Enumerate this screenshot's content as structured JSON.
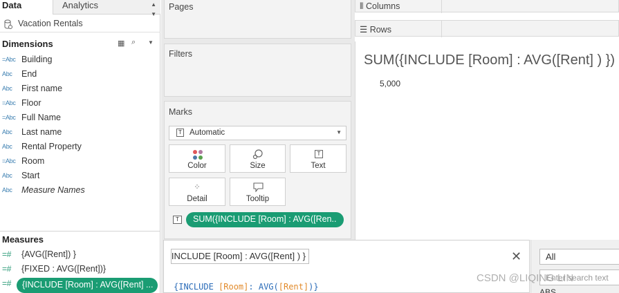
{
  "tabs": {
    "data": "Data",
    "analytics": "Analytics"
  },
  "datasource": "Vacation Rentals",
  "dimensions": {
    "title": "Dimensions",
    "fields": [
      {
        "type": "=Abc",
        "label": "Building"
      },
      {
        "type": "Abc",
        "label": "End"
      },
      {
        "type": "Abc",
        "label": "First name"
      },
      {
        "type": "=Abc",
        "label": "Floor"
      },
      {
        "type": "=Abc",
        "label": "Full Name"
      },
      {
        "type": "Abc",
        "label": "Last name"
      },
      {
        "type": "Abc",
        "label": "Rental Property"
      },
      {
        "type": "=Abc",
        "label": "Room"
      },
      {
        "type": "Abc",
        "label": "Start"
      },
      {
        "type": "Abc",
        "label": "Measure Names"
      }
    ]
  },
  "measures": {
    "title": "Measures",
    "fields": [
      {
        "type": "=#",
        "label": "{AVG([Rent]) }"
      },
      {
        "type": "=#",
        "label": "{FIXED : AVG([Rent])}"
      },
      {
        "type": "=#",
        "label": "{INCLUDE [Room] : AVG([Rent] ..."
      }
    ]
  },
  "shelves": {
    "pages": "Pages",
    "filters": "Filters",
    "marks": "Marks",
    "columns": "Columns",
    "rows": "Rows"
  },
  "marks": {
    "mark_type": "Automatic",
    "buttons": {
      "color": "Color",
      "size": "Size",
      "text": "Text",
      "detail": "Detail",
      "tooltip": "Tooltip"
    },
    "pill": "SUM({INCLUDE [Room] : AVG([Ren.."
  },
  "viz": {
    "title": "SUM({INCLUDE [Room] : AVG([Rent] ) })",
    "value": "5,000"
  },
  "editor": {
    "name": "{INCLUDE [Room] : AVG([Rent] ) }",
    "code": {
      "p1": "{INCLUDE ",
      "p2": "[Room]",
      "p3": ": AVG(",
      "p4": "[Rent]",
      "p5": ")}"
    }
  },
  "functions": {
    "filter_value": "All",
    "search_placeholder": "Enter search text",
    "list_first": "ABS"
  },
  "watermark": "CSDN @LIQING LIN",
  "colors": {
    "green": "#1a9c73",
    "code_blue": "#2a6bb8",
    "code_orange": "#e28a2a"
  }
}
